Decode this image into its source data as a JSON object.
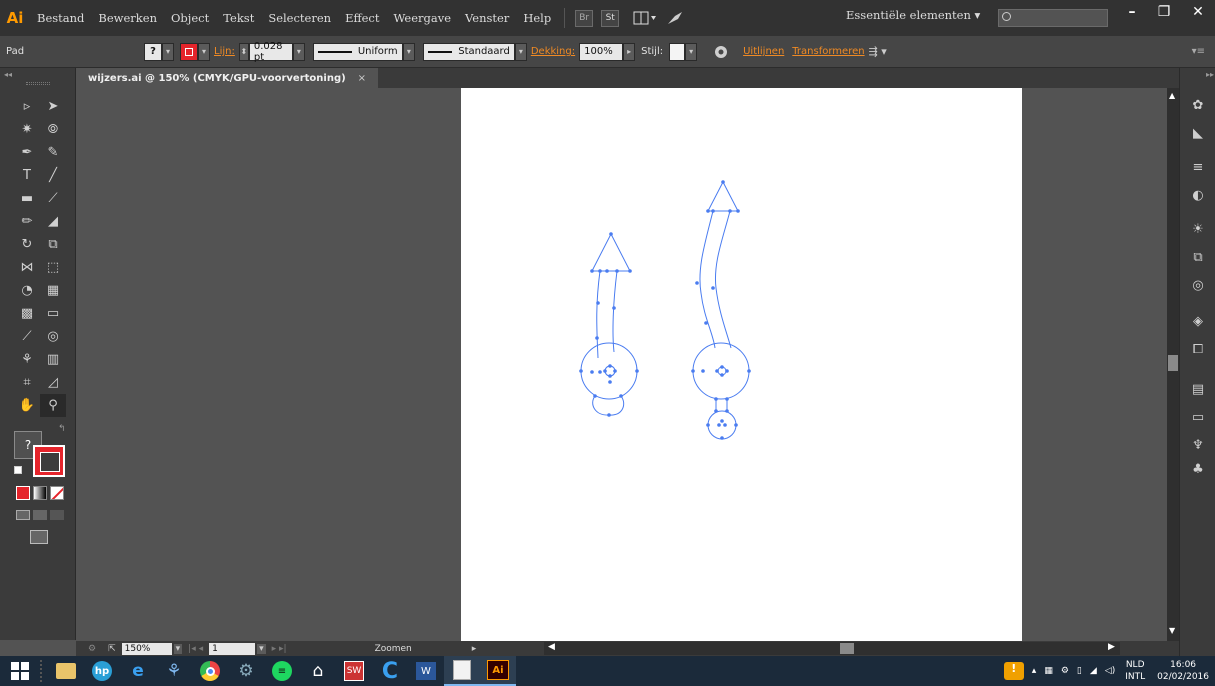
{
  "menubar": {
    "logo": "Ai",
    "items": [
      "Bestand",
      "Bewerken",
      "Object",
      "Tekst",
      "Selecteren",
      "Effect",
      "Weergave",
      "Venster",
      "Help"
    ],
    "bridge_label": "Br",
    "stock_label": "St",
    "workspace": "Essentiële elementen",
    "minimize": "–",
    "restore": "❐",
    "close": "✕"
  },
  "controlbar": {
    "selection_type": "Pad",
    "stroke_label": "Lijn:",
    "stroke_weight": "0.028 pt",
    "profile_label": "Uniform",
    "brush_label": "Standaard",
    "opacity_label": "Dekking:",
    "opacity_value": "100%",
    "style_label": "Stijl:",
    "align_label": "Uitlijnen",
    "transform_label": "Transformeren"
  },
  "document_tab": {
    "title": "wijzers.ai @ 150% (CMYK/GPU-voorvertoning)",
    "close": "×"
  },
  "statusbar": {
    "zoom": "150%",
    "artboard_number": "1",
    "tool_status": "Zoomen"
  },
  "tray": {
    "language": "NLD",
    "layout": "INTL",
    "time": "16:06",
    "date": "02/02/2016"
  },
  "colors": {
    "stroke": "#e5242b",
    "path": "#4a7cf0",
    "canvas": "#ffffff"
  }
}
